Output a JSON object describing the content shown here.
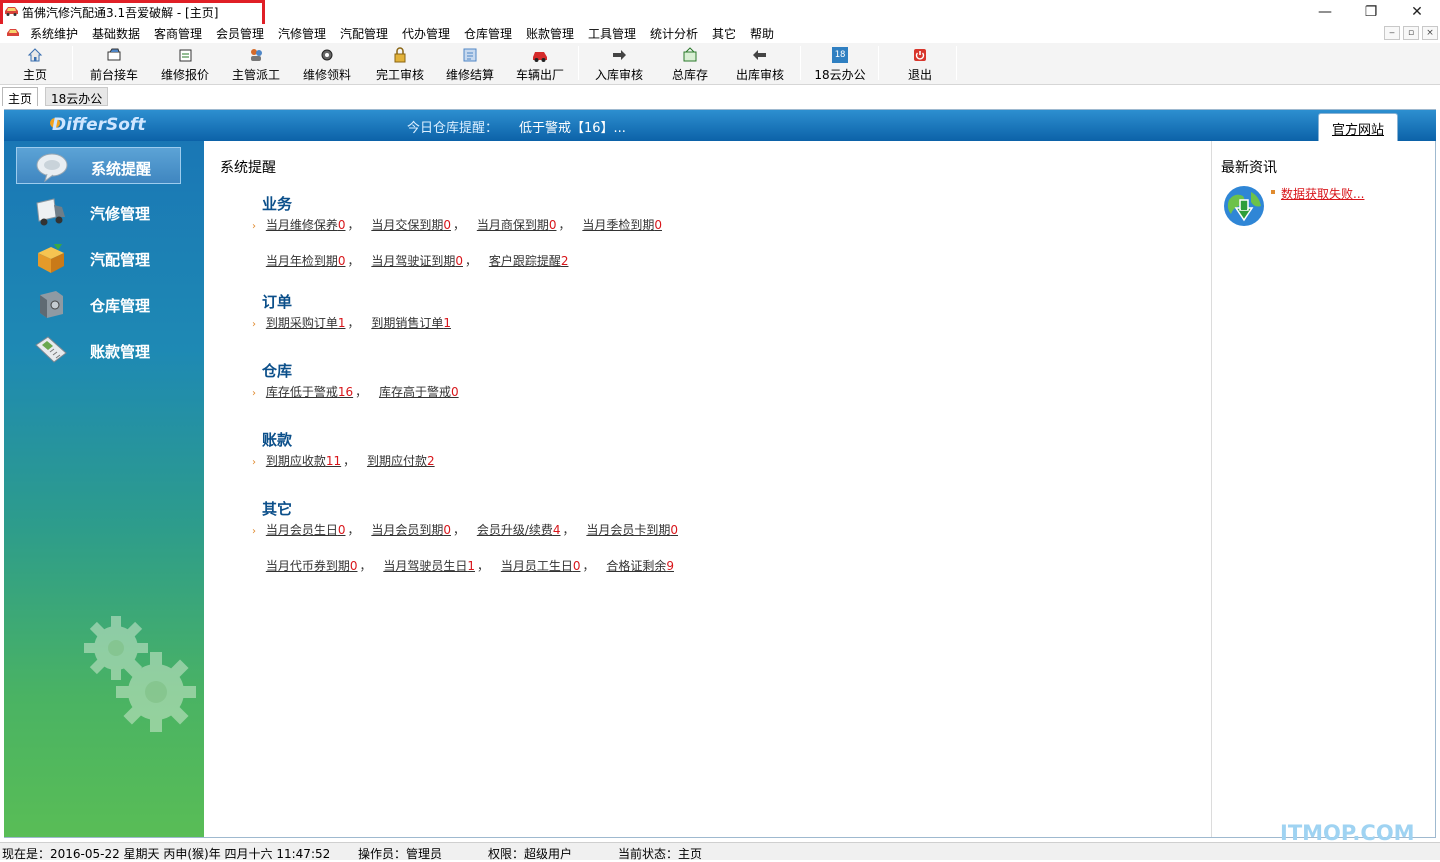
{
  "window": {
    "title": "笛佛汽修汽配通3.1吾爱破解 - [主页]",
    "controls": {
      "minimize": "—",
      "restore": "❐",
      "close": "✕"
    },
    "accent_highlight": "#e01f26"
  },
  "menu": {
    "items": [
      "系统维护",
      "基础数据",
      "客商管理",
      "会员管理",
      "汽修管理",
      "汽配管理",
      "代办管理",
      "仓库管理",
      "账款管理",
      "工具管理",
      "统计分析",
      "其它",
      "帮助"
    ],
    "mdi": {
      "minimize": "‒",
      "restore": "▫",
      "close": "×"
    }
  },
  "toolbar": {
    "items": [
      {
        "label": "主页",
        "icon": "home-icon"
      },
      {
        "label": "前台接车",
        "icon": "reception-icon"
      },
      {
        "label": "维修报价",
        "icon": "quote-icon"
      },
      {
        "label": "主管派工",
        "icon": "dispatch-icon"
      },
      {
        "label": "维修领料",
        "icon": "materials-icon"
      },
      {
        "label": "完工审核",
        "icon": "completion-lock-icon"
      },
      {
        "label": "维修结算",
        "icon": "settlement-icon"
      },
      {
        "label": "车辆出厂",
        "icon": "car-exit-icon"
      },
      {
        "label": "入库审核",
        "icon": "stock-in-icon"
      },
      {
        "label": "总库存",
        "icon": "inventory-icon"
      },
      {
        "label": "出库审核",
        "icon": "stock-out-icon"
      },
      {
        "label": "18云办公",
        "icon": "calendar-icon",
        "icon_text": "18"
      },
      {
        "label": "退出",
        "icon": "exit-icon"
      }
    ]
  },
  "tabs": [
    {
      "label": "主页",
      "active": true
    },
    {
      "label": "18云办公",
      "active": false
    }
  ],
  "header": {
    "brand": "DifferSoft",
    "reminder_label": "今日仓库提醒：",
    "reminder_value": "低于警戒【16】...",
    "official_site": "官方网站",
    "band_color": "#1674bb"
  },
  "sidebar": {
    "items": [
      {
        "label": "系统提醒",
        "icon": "reminder-bubble-icon",
        "active": true
      },
      {
        "label": "汽修管理",
        "icon": "truck-icon",
        "active": false
      },
      {
        "label": "汽配管理",
        "icon": "parts-box-icon",
        "active": false
      },
      {
        "label": "仓库管理",
        "icon": "safe-icon",
        "active": false
      },
      {
        "label": "账款管理",
        "icon": "payment-terminal-icon",
        "active": false
      }
    ]
  },
  "content": {
    "title": "系统提醒",
    "sections": [
      {
        "title": "业务",
        "lines": [
          [
            {
              "text": "当月维修保养",
              "count": "0"
            },
            {
              "text": "当月交保到期",
              "count": "0"
            },
            {
              "text": "当月商保到期",
              "count": "0"
            },
            {
              "text": "当月季检到期",
              "count": "0"
            }
          ],
          [
            {
              "text": "当月年检到期",
              "count": "0"
            },
            {
              "text": "当月驾驶证到期",
              "count": "0"
            },
            {
              "text": "客户跟踪提醒",
              "count": "2"
            }
          ]
        ]
      },
      {
        "title": "订单",
        "lines": [
          [
            {
              "text": "到期采购订单",
              "count": "1"
            },
            {
              "text": "到期销售订单",
              "count": "1"
            }
          ]
        ]
      },
      {
        "title": "仓库",
        "lines": [
          [
            {
              "text": "库存低于警戒",
              "count": "16"
            },
            {
              "text": "库存高于警戒",
              "count": "0"
            }
          ]
        ]
      },
      {
        "title": "账款",
        "lines": [
          [
            {
              "text": "到期应收款",
              "count": "11"
            },
            {
              "text": "到期应付款",
              "count": "2"
            }
          ]
        ]
      },
      {
        "title": "其它",
        "lines": [
          [
            {
              "text": "当月会员生日",
              "count": "0"
            },
            {
              "text": "当月会员到期",
              "count": "0"
            },
            {
              "text": "会员升级/续费",
              "count": "4"
            },
            {
              "text": "当月会员卡到期",
              "count": "0"
            }
          ],
          [
            {
              "text": "当月代币券到期",
              "count": "0"
            },
            {
              "text": "当月驾驶员生日",
              "count": "1"
            },
            {
              "text": "当月员工生日",
              "count": "0"
            },
            {
              "text": "合格证剩余",
              "count": "9"
            }
          ]
        ]
      }
    ],
    "separator": "，"
  },
  "news": {
    "title": "最新资讯",
    "link": "数据获取失败..."
  },
  "watermark": "ITMOP.COM",
  "status": {
    "now": "现在是：2016-05-22 星期天 丙申(猴)年 四月十六 11:47:52",
    "operator": "操作员：管理员",
    "permission": "权限：超级用户",
    "state": "当前状态：主页"
  }
}
